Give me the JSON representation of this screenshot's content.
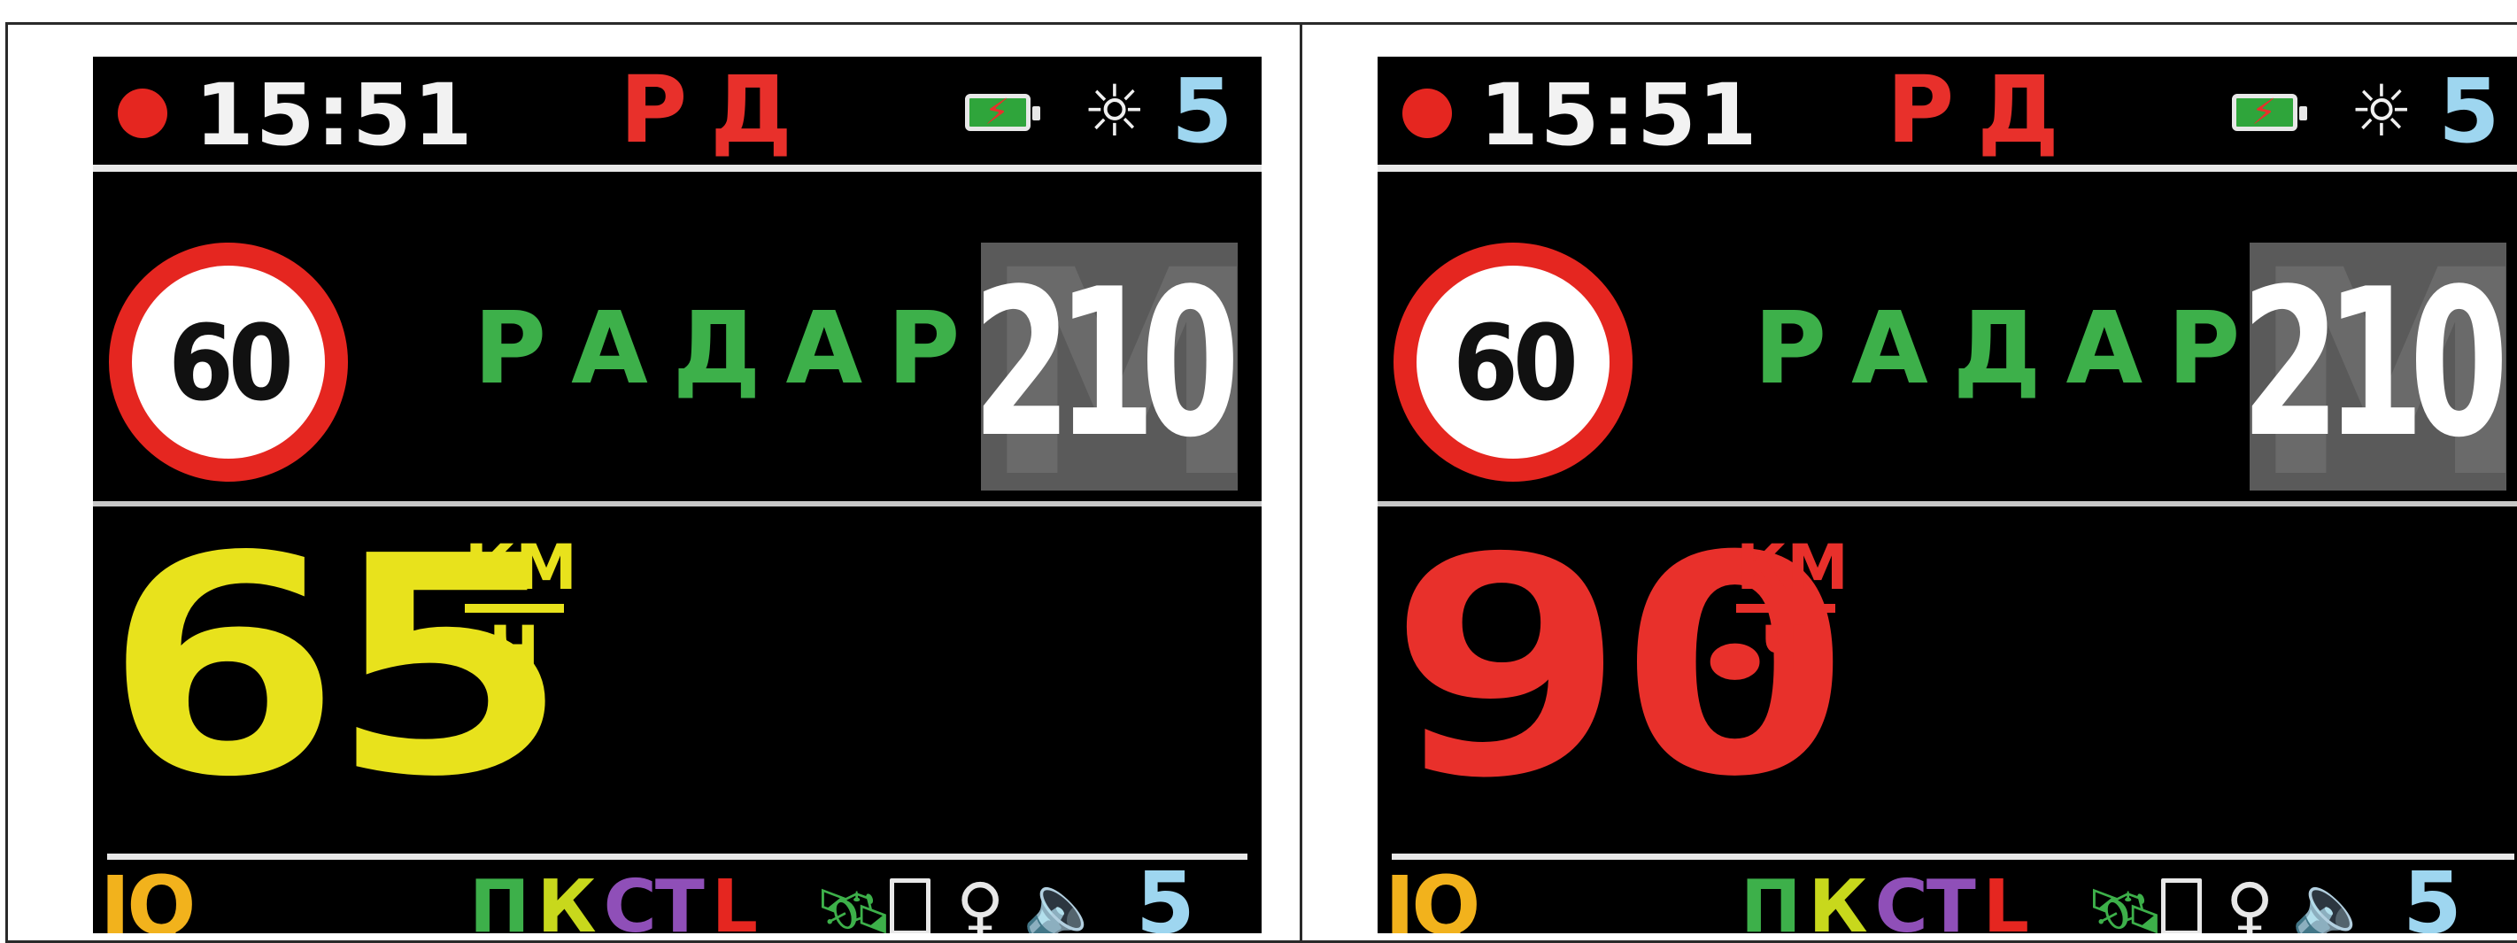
{
  "colors": {
    "rec_dot": "#e52620",
    "mode": "#e8302b",
    "alert": "#3db04a",
    "bright": "#9ed6f0",
    "iq": "#f2b21c",
    "speed_normal": "#e8e21c",
    "speed_over": "#e8302b"
  },
  "screens": [
    {
      "status": {
        "time": "15:51",
        "mode": "РД",
        "battery_icon": "battery-charging-icon",
        "brightness_icon": "sun-icon",
        "brightness": "5"
      },
      "alert": {
        "speed_limit": "60",
        "type": "РАДАР",
        "distance": "210",
        "distance_unit_icon": "M"
      },
      "speed": {
        "value": "65",
        "unit_top": "КМ",
        "unit_bottom": "Ч",
        "color": "#e8e21c"
      },
      "bottom": {
        "iq": "IQ",
        "flags": [
          {
            "label": "П",
            "color": "#3db04a"
          },
          {
            "label": "К",
            "color": "#c8d81c"
          },
          {
            "label": "СТ",
            "color": "#8f4fb8"
          },
          {
            "label": "L",
            "color": "#e52620"
          }
        ],
        "satellite_icon": "satellite-icon",
        "card_icon": "sd-card-icon",
        "mic_icon": "microphone-icon",
        "speaker_icon": "speaker-icon",
        "volume": "5"
      }
    },
    {
      "status": {
        "time": "15:51",
        "mode": "РД",
        "battery_icon": "battery-charging-icon",
        "brightness_icon": "sun-icon",
        "brightness": "5"
      },
      "alert": {
        "speed_limit": "60",
        "type": "РАДАР",
        "distance": "210",
        "distance_unit_icon": "M"
      },
      "speed": {
        "value": "90",
        "unit_top": "КМ",
        "unit_bottom": "Ч",
        "color": "#e8302b"
      },
      "bottom": {
        "iq": "IQ",
        "flags": [
          {
            "label": "П",
            "color": "#3db04a"
          },
          {
            "label": "К",
            "color": "#c8d81c"
          },
          {
            "label": "СТ",
            "color": "#8f4fb8"
          },
          {
            "label": "L",
            "color": "#e52620"
          }
        ],
        "satellite_icon": "satellite-icon",
        "card_icon": "sd-card-icon",
        "mic_icon": "microphone-icon",
        "speaker_icon": "speaker-icon",
        "volume": "5"
      }
    }
  ]
}
